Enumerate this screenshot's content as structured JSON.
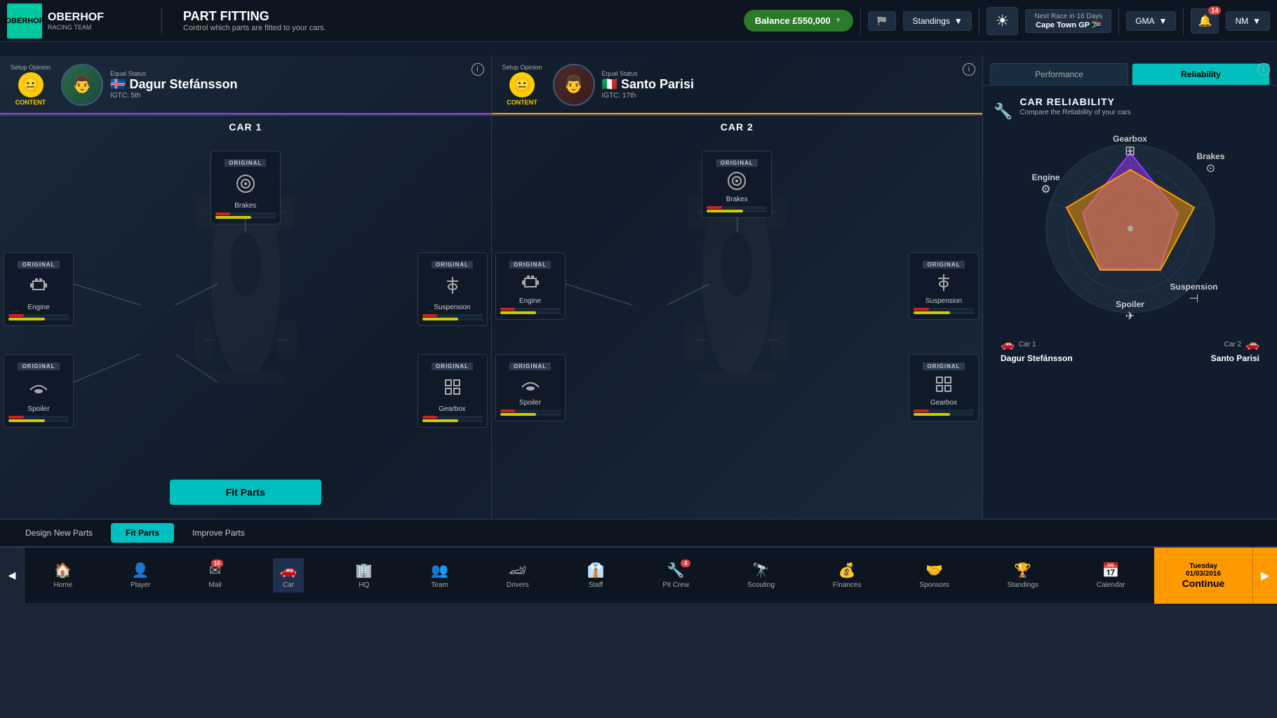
{
  "app": {
    "logo": "OBERHOF",
    "sub": "RACING TEAM",
    "page_title": "PART FITTING",
    "page_subtitle": "Control which parts are fitted to your cars."
  },
  "topbar": {
    "balance": "Balance £550,000",
    "balance_chevron": "▼",
    "standings": "Standings",
    "standings_chevron": "▼",
    "weather_icon": "☀",
    "next_race_label": "Next Race in 16 Days",
    "next_race_name": "Cape Town GP",
    "next_race_flag": "🇿🇦",
    "gma_label": "GMA",
    "notif_count": "14",
    "profile": "NM"
  },
  "car1": {
    "title": "CAR 1",
    "driver": {
      "equal_status": "Equal Status",
      "flag": "🇮🇸",
      "name": "Dagur Stefánsson",
      "standing": "IGTC: 5th",
      "setup_opinion": "Setup Opinion",
      "status": "CONTENT",
      "emoji": "😐"
    },
    "parts": {
      "brakes": {
        "label": "ORIGINAL",
        "name": "Brakes",
        "icon": "⚙",
        "bar1": 25,
        "bar2": 60
      },
      "engine": {
        "label": "ORIGINAL",
        "name": "Engine",
        "icon": "🔧",
        "bar1": 25,
        "bar2": 60
      },
      "suspension": {
        "label": "ORIGINAL",
        "name": "Suspension",
        "icon": "🔩",
        "bar1": 25,
        "bar2": 60
      },
      "spoiler": {
        "label": "ORIGINAL",
        "name": "Spoiler",
        "icon": "✈",
        "bar1": 25,
        "bar2": 60
      },
      "gearbox": {
        "label": "ORIGINAL",
        "name": "Gearbox",
        "icon": "⚙",
        "bar1": 25,
        "bar2": 60
      }
    }
  },
  "car2": {
    "title": "CAR 2",
    "driver": {
      "equal_status": "Equal Status",
      "flag": "🇮🇹",
      "name": "Santo Parisi",
      "standing": "IGTC: 17th",
      "setup_opinion": "Setup Opinion",
      "status": "CONTENT",
      "emoji": "😐"
    },
    "parts": {
      "brakes": {
        "label": "ORIGINAL",
        "name": "Brakes",
        "icon": "⚙",
        "bar1": 25,
        "bar2": 60
      },
      "engine": {
        "label": "ORIGINAL",
        "name": "Engine",
        "icon": "🔧",
        "bar1": 25,
        "bar2": 60
      },
      "suspension": {
        "label": "ORIGINAL",
        "name": "Suspension",
        "icon": "🔩",
        "bar1": 25,
        "bar2": 60
      },
      "spoiler": {
        "label": "ORIGINAL",
        "name": "Spoiler",
        "icon": "✈",
        "bar1": 25,
        "bar2": 60
      },
      "gearbox": {
        "label": "ORIGINAL",
        "name": "Gearbox",
        "icon": "⚙",
        "bar1": 25,
        "bar2": 60
      }
    }
  },
  "reliability": {
    "title": "CAR RELIABILITY",
    "subtitle": "Compare the Reliability of your cars",
    "tabs": {
      "performance": "Performance",
      "reliability": "Reliability"
    },
    "labels": {
      "gearbox": "Gearbox",
      "brakes": "Brakes",
      "engine": "Engine",
      "suspension": "Suspension",
      "spoiler": "Spoiler"
    },
    "legend": {
      "car1": {
        "label": "Car 1",
        "driver": "Dagur Stefánsson",
        "color": "#9933ff"
      },
      "car2": {
        "label": "Car 2",
        "driver": "Santo Parisi",
        "color": "#ff9900"
      }
    }
  },
  "bottom_tabs": {
    "design": "Design New Parts",
    "fit": "Fit Parts",
    "improve": "Improve Parts"
  },
  "fit_parts_btn": "Fit Parts",
  "navbar": {
    "items": [
      {
        "icon": "🏠",
        "label": "Home",
        "badge": null
      },
      {
        "icon": "👤",
        "label": "Player",
        "badge": null
      },
      {
        "icon": "✉",
        "label": "Mail",
        "badge": "10"
      },
      {
        "icon": "🚗",
        "label": "Car",
        "badge": null,
        "active": true
      },
      {
        "icon": "🏢",
        "label": "HQ",
        "badge": null
      },
      {
        "icon": "👥",
        "label": "Team",
        "badge": null
      },
      {
        "icon": "🏎",
        "label": "Drivers",
        "badge": null
      },
      {
        "icon": "👔",
        "label": "Staff",
        "badge": null
      },
      {
        "icon": "🔧",
        "label": "Pit Crew",
        "badge": "4"
      },
      {
        "icon": "🔭",
        "label": "Scouting",
        "badge": null
      },
      {
        "icon": "💰",
        "label": "Finances",
        "badge": null
      },
      {
        "icon": "🤝",
        "label": "Sponsors",
        "badge": null
      },
      {
        "icon": "🏆",
        "label": "Standings",
        "badge": null
      },
      {
        "icon": "📅",
        "label": "Calendar",
        "badge": null
      }
    ],
    "continue": {
      "day": "Tuesday",
      "date": "01/03/2016",
      "label": "Continue"
    }
  }
}
